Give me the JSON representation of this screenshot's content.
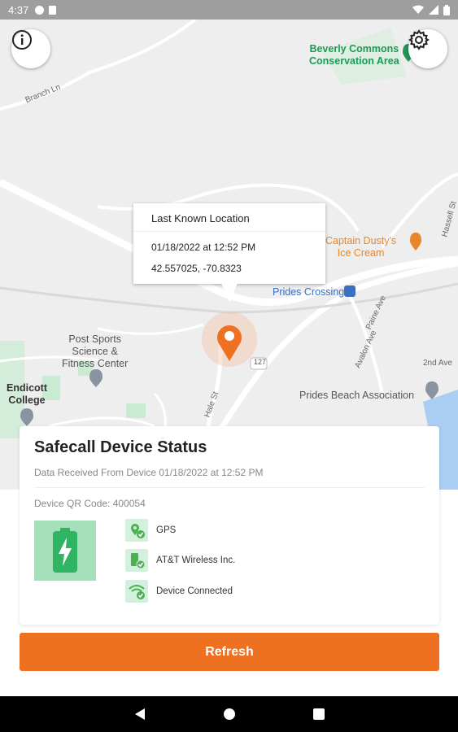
{
  "status_bar": {
    "time": "4:37"
  },
  "map": {
    "poi": {
      "beverly_commons": "Beverly Commons\nConservation Area",
      "captain_dustys": "Captain Dusty's\nIce Cream",
      "prides_crossing": "Prides Crossing",
      "post_sports": "Post Sports\nScience &\nFitness Center",
      "endicott": "Endicott\nCollege",
      "prides_beach": "Prides Beach Association"
    },
    "roads": {
      "branch_ln": "Branch Ln",
      "hale_st": "Hale St",
      "route_127": "127",
      "avalon_ave": "Avalon Ave",
      "paine_ave": "Paine Ave",
      "hassell_st": "Hassell St",
      "second_ave": "2nd Ave"
    }
  },
  "info_window": {
    "title": "Last Known Location",
    "datetime": "01/18/2022 at 12:52 PM",
    "coordinates": "42.557025, -70.8323"
  },
  "status_card": {
    "title": "Safecall Device Status",
    "data_received": "Data Received From Device 01/18/2022 at 12:52 PM",
    "qr_code": "Device QR Code: 400054",
    "items": [
      {
        "icon": "gps-check-icon",
        "label": "GPS"
      },
      {
        "icon": "carrier-check-icon",
        "label": "AT&T Wireless Inc."
      },
      {
        "icon": "wifi-check-icon",
        "label": "Device Connected"
      }
    ]
  },
  "refresh_button": {
    "label": "Refresh"
  },
  "colors": {
    "accent": "#ee7121",
    "status_green": "#4caf50",
    "status_green_light": "#d2f0dc",
    "map_bg": "#eeeeee"
  }
}
